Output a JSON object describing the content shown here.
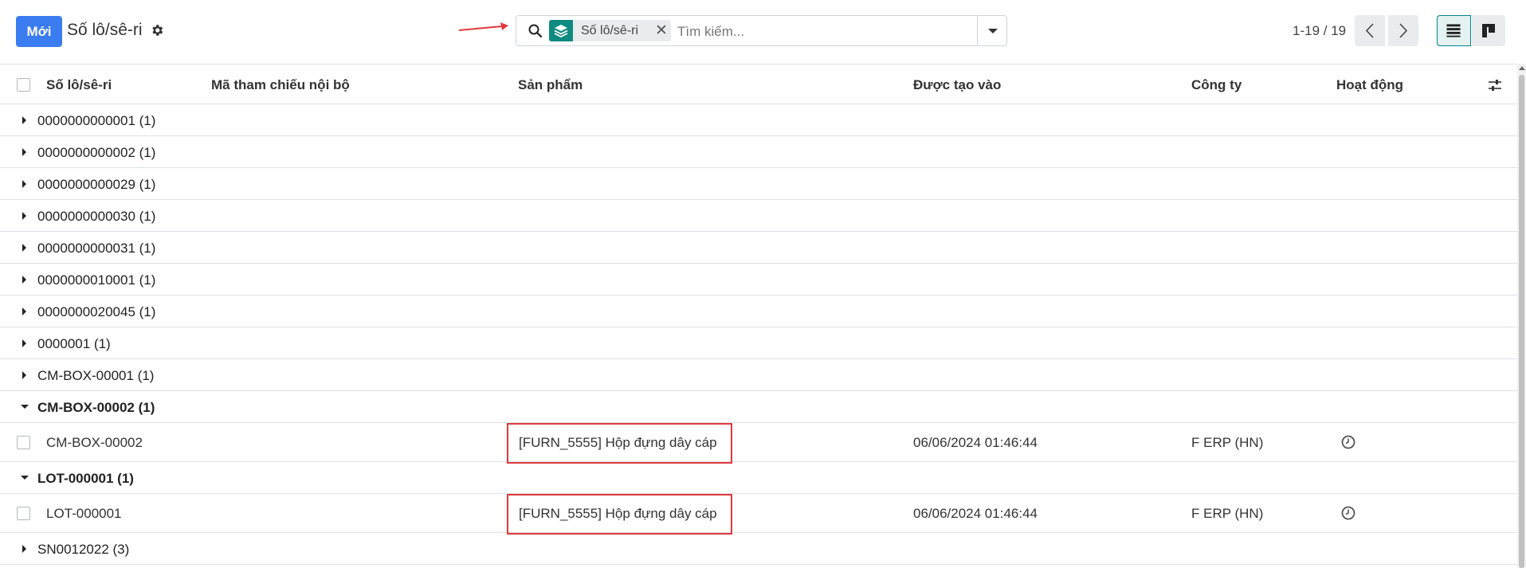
{
  "toolbar": {
    "new_label": "Mới",
    "title": "Số lô/sê-ri"
  },
  "search": {
    "facet_label": "Số lô/sê-ri",
    "placeholder": "Tìm kiếm..."
  },
  "pager": {
    "value": "1-19 / 19"
  },
  "columns": {
    "lot": "Số lô/sê-ri",
    "ref": "Mã tham chiếu nội bộ",
    "product": "Sản phẩm",
    "created": "Được tạo vào",
    "company": "Công ty",
    "activity": "Hoạt động"
  },
  "groups": [
    {
      "label": "0000000000001 (1)"
    },
    {
      "label": "0000000000002 (1)"
    },
    {
      "label": "0000000000029 (1)"
    },
    {
      "label": "0000000000030 (1)"
    },
    {
      "label": "0000000000031 (1)"
    },
    {
      "label": "0000000010001 (1)"
    },
    {
      "label": "0000000020045 (1)"
    },
    {
      "label": "0000001 (1)"
    },
    {
      "label": "CM-BOX-00001 (1)"
    },
    {
      "label": "CM-BOX-00002 (1)",
      "record": {
        "lot": "CM-BOX-00002",
        "product": "[FURN_5555] Hộp đựng dây cáp",
        "created": "06/06/2024 01:46:44",
        "company": "F ERP (HN)"
      }
    },
    {
      "label": "LOT-000001 (1)",
      "record": {
        "lot": "LOT-000001",
        "product": "[FURN_5555] Hộp đựng dây cáp",
        "created": "06/06/2024 01:46:44",
        "company": "F ERP (HN)"
      }
    },
    {
      "label": "SN0012022 (3)"
    }
  ],
  "colors": {
    "primary": "#3b7cf0",
    "facet": "#0f8a80",
    "highlight": "#e0393e",
    "active_view": "#00848b"
  }
}
